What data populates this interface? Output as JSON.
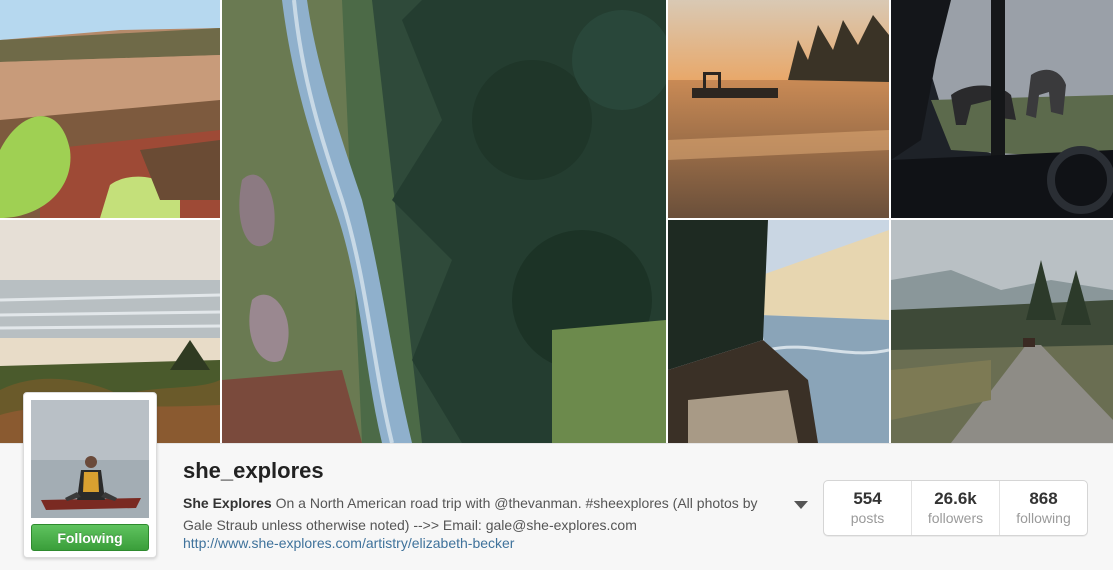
{
  "profile": {
    "username": "she_explores",
    "full_name": "She Explores",
    "bio_text": "On a North American road trip with @thevanman. #sheexplores (All photos by Gale Straub unless otherwise noted) -->> Email: gale@she-explores.com",
    "website": "http://www.she-explores.com/artistry/elizabeth-becker",
    "follow_button_label": "Following",
    "avatar_icon": "woman-in-canoe-photo"
  },
  "stats": [
    {
      "value": "554",
      "label": "posts"
    },
    {
      "value": "26.6k",
      "label": "followers"
    },
    {
      "value": "868",
      "label": "following"
    }
  ],
  "photos": [
    {
      "icon": "canyon-cliffs-photo"
    },
    {
      "icon": "forest-creek-aerial-photo"
    },
    {
      "icon": "lake-sunrise-dock-photo"
    },
    {
      "icon": "horses-through-car-window-photo"
    },
    {
      "icon": "beach-ocean-photo"
    },
    {
      "icon": "sand-dune-lake-photo"
    },
    {
      "icon": "foggy-dirt-road-photo"
    }
  ],
  "colors": {
    "follow_button": "#4cae4c",
    "link": "#3f729b"
  }
}
